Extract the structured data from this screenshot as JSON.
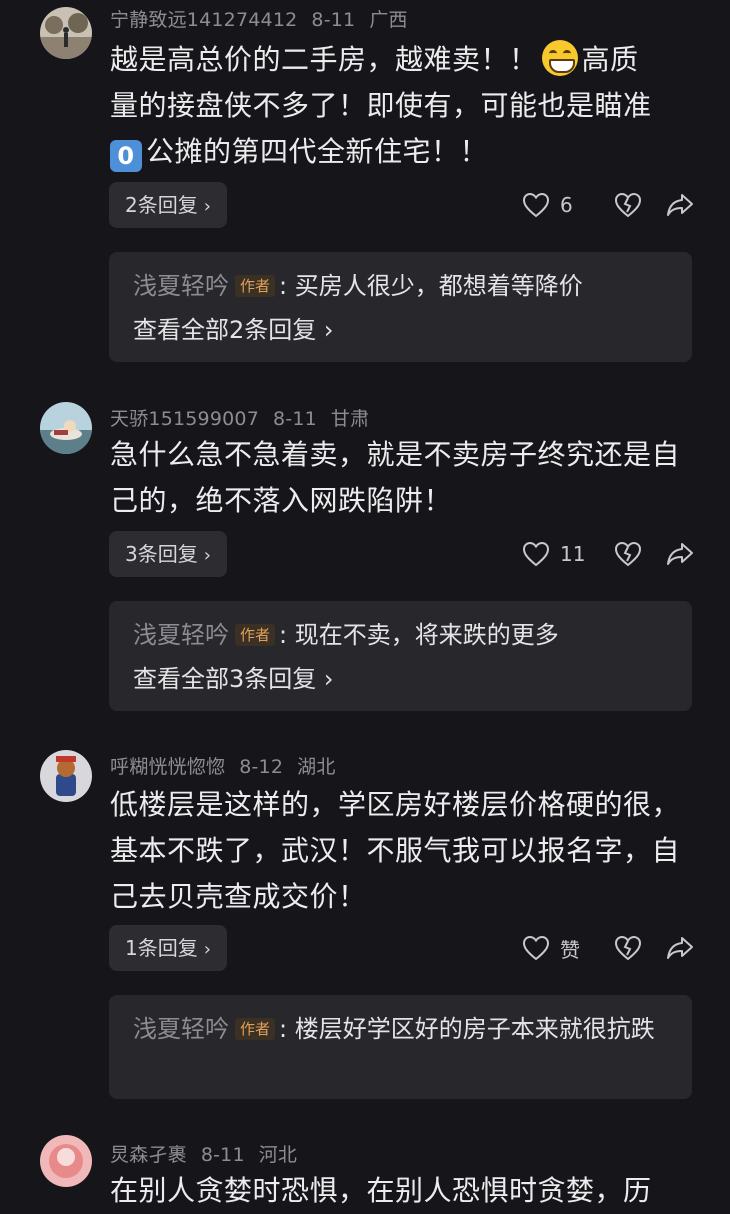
{
  "comments": [
    {
      "username": "宁静致远141274412",
      "date": "8-11",
      "location": "广西",
      "text_line1": "越是高总价的二手房，越难卖！！",
      "text_line1_tail": "高质",
      "text_line2": "量的接盘侠不多了！即使有，可能也是瞄准",
      "keycap": "0",
      "text_line3": "公摊的第四代全新住宅！！",
      "emoji_icon": "grinning-face-icon",
      "reply_count_label": "2条回复",
      "like_count": "6",
      "sub_reply": {
        "name": "浅夏轻吟",
        "tag": "作者",
        "text": "买房人很少，都想着等降价",
        "view_all": "查看全部2条回复"
      }
    },
    {
      "username": "天骄151599007",
      "date": "8-11",
      "location": "甘肃",
      "text": "急什么急不急着卖，就是不卖房子终究还是自己的，绝不落入网跌陷阱！",
      "reply_count_label": "3条回复",
      "like_count": "11",
      "sub_reply": {
        "name": "浅夏轻吟",
        "tag": "作者",
        "text": "现在不卖，将来跌的更多",
        "view_all": "查看全部3条回复"
      }
    },
    {
      "username": "呼糊恍恍惚惚",
      "date": "8-12",
      "location": "湖北",
      "text": "低楼层是这样的，学区房好楼层价格硬的很，基本不跌了，武汉！不服气我可以报名字，自己去贝壳查成交价！",
      "reply_count_label": "1条回复",
      "like_count": "赞",
      "sub_reply": {
        "name": "浅夏轻吟",
        "tag": "作者",
        "text": "楼层好学区好的房子本来就很抗跌"
      }
    },
    {
      "username": "炅森孑裹",
      "date": "8-11",
      "location": "河北",
      "text": "在别人贪婪时恐惧，在别人恐惧时贪婪，历"
    }
  ],
  "colors": {
    "background": "#16161a",
    "meta_gray": "#8c8c92",
    "author_tag": "#e0a05a",
    "pill_bg": "#2c2c31",
    "sub_box_bg": "#27272c"
  }
}
